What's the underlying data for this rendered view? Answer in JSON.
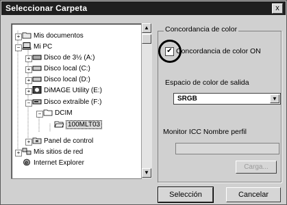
{
  "window": {
    "title": "Seleccionar Carpeta",
    "close": "x"
  },
  "tree": [
    {
      "label": "Mis documentos",
      "icon": "documents-folder-icon"
    },
    {
      "label": "Mi PC",
      "icon": "computer-icon"
    },
    {
      "label": "Disco de 3½ (A:)",
      "icon": "floppy-drive-icon"
    },
    {
      "label": "Disco local (C:)",
      "icon": "hard-drive-icon"
    },
    {
      "label": "Disco local (D:)",
      "icon": "hard-drive-icon"
    },
    {
      "label": "DiMAGE Utility (E:)",
      "icon": "cd-drive-icon"
    },
    {
      "label": "Disco extraíble (F:)",
      "icon": "removable-drive-icon"
    },
    {
      "label": "DCIM",
      "icon": "folder-icon"
    },
    {
      "label": "100MLT03",
      "icon": "folder-open-icon"
    },
    {
      "label": "Panel de control",
      "icon": "control-panel-icon"
    },
    {
      "label": "Mis sitios de red",
      "icon": "network-icon"
    },
    {
      "label": "Internet Explorer",
      "icon": "internet-explorer-icon"
    }
  ],
  "panel": {
    "group_label": "Concordancia de color",
    "checkbox_label": "Concordancia de color ON",
    "checkbox_checked": true,
    "output_label": "Espacio de color de salida",
    "output_value": "SRGB",
    "icc_label": "Monitor ICC Nombre perfil",
    "icc_value": "",
    "load_button": "Carga..."
  },
  "buttons": {
    "select": "Selección",
    "cancel": "Cancelar"
  }
}
